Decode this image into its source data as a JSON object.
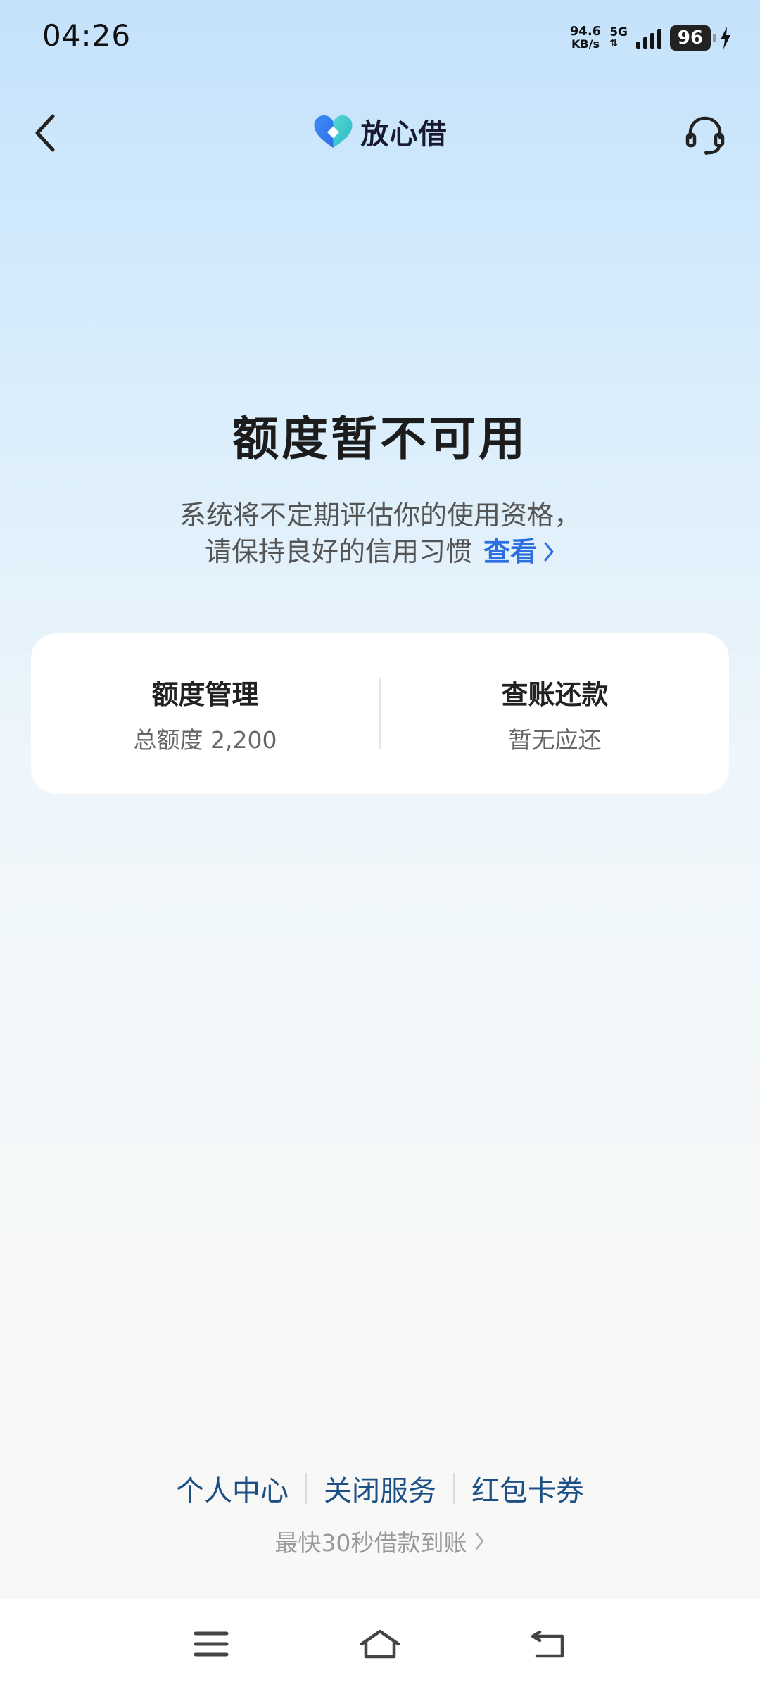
{
  "status_bar": {
    "time": "04:26",
    "net_speed_value": "94.6",
    "net_speed_unit": "KB/s",
    "network_type": "5G",
    "battery": "96"
  },
  "header": {
    "app_name": "放心借",
    "logo_icon": "heart-logo-icon",
    "back_icon": "chevron-left-icon",
    "support_icon": "headset-icon"
  },
  "main": {
    "title": "额度暂不可用",
    "desc_line1": "系统将不定期评估你的使用资格，",
    "desc_line2": "请保持良好的信用习惯",
    "view_link": "查看"
  },
  "card": {
    "left_title": "额度管理",
    "left_sub": "总额度 2,200",
    "right_title": "查账还款",
    "right_sub": "暂无应还"
  },
  "footer": {
    "links": [
      "个人中心",
      "关闭服务",
      "红包卡券"
    ],
    "promo": "最快30秒借款到账"
  },
  "colors": {
    "accent": "#2d6fe0",
    "link": "#1c4f86"
  }
}
